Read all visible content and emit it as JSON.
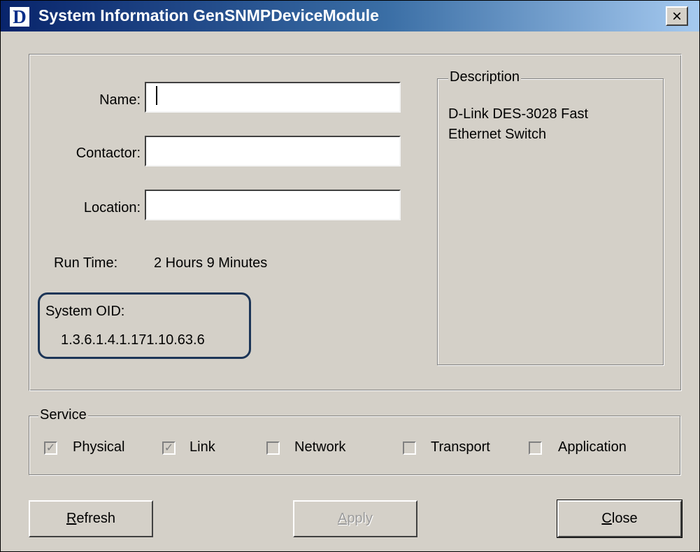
{
  "window": {
    "icon_letter": "D",
    "title": "System Information GenSNMPDeviceModule",
    "close_glyph": "×"
  },
  "fields": {
    "name_label": "Name:",
    "name_value": "",
    "contactor_label": "Contactor:",
    "contactor_value": "",
    "location_label": "Location:",
    "location_value": ""
  },
  "runtime": {
    "label": "Run Time:",
    "value": "2 Hours 9 Minutes"
  },
  "system_oid": {
    "label": "System OID:",
    "value": "1.3.6.1.4.1.171.10.63.6"
  },
  "description": {
    "legend": "Description",
    "line1": "D-Link DES-3028 Fast",
    "line2": "Ethernet Switch"
  },
  "service": {
    "legend": "Service",
    "items": [
      {
        "label": "Physical",
        "checked": true,
        "enabled": false
      },
      {
        "label": "Link",
        "checked": true,
        "enabled": false
      },
      {
        "label": "Network",
        "checked": false,
        "enabled": false
      },
      {
        "label": "Transport",
        "checked": false,
        "enabled": false
      },
      {
        "label": "Application",
        "checked": false,
        "enabled": false
      }
    ]
  },
  "buttons": {
    "refresh_first": "R",
    "refresh_rest": "efresh",
    "apply_first": "A",
    "apply_rest": "pply",
    "close_first": "C",
    "close_rest": "lose"
  },
  "colors": {
    "titlebar_start": "#08246b",
    "titlebar_end": "#a6caf0",
    "dialog_face": "#d4d0c8",
    "highlight_box": "#1c3557"
  }
}
